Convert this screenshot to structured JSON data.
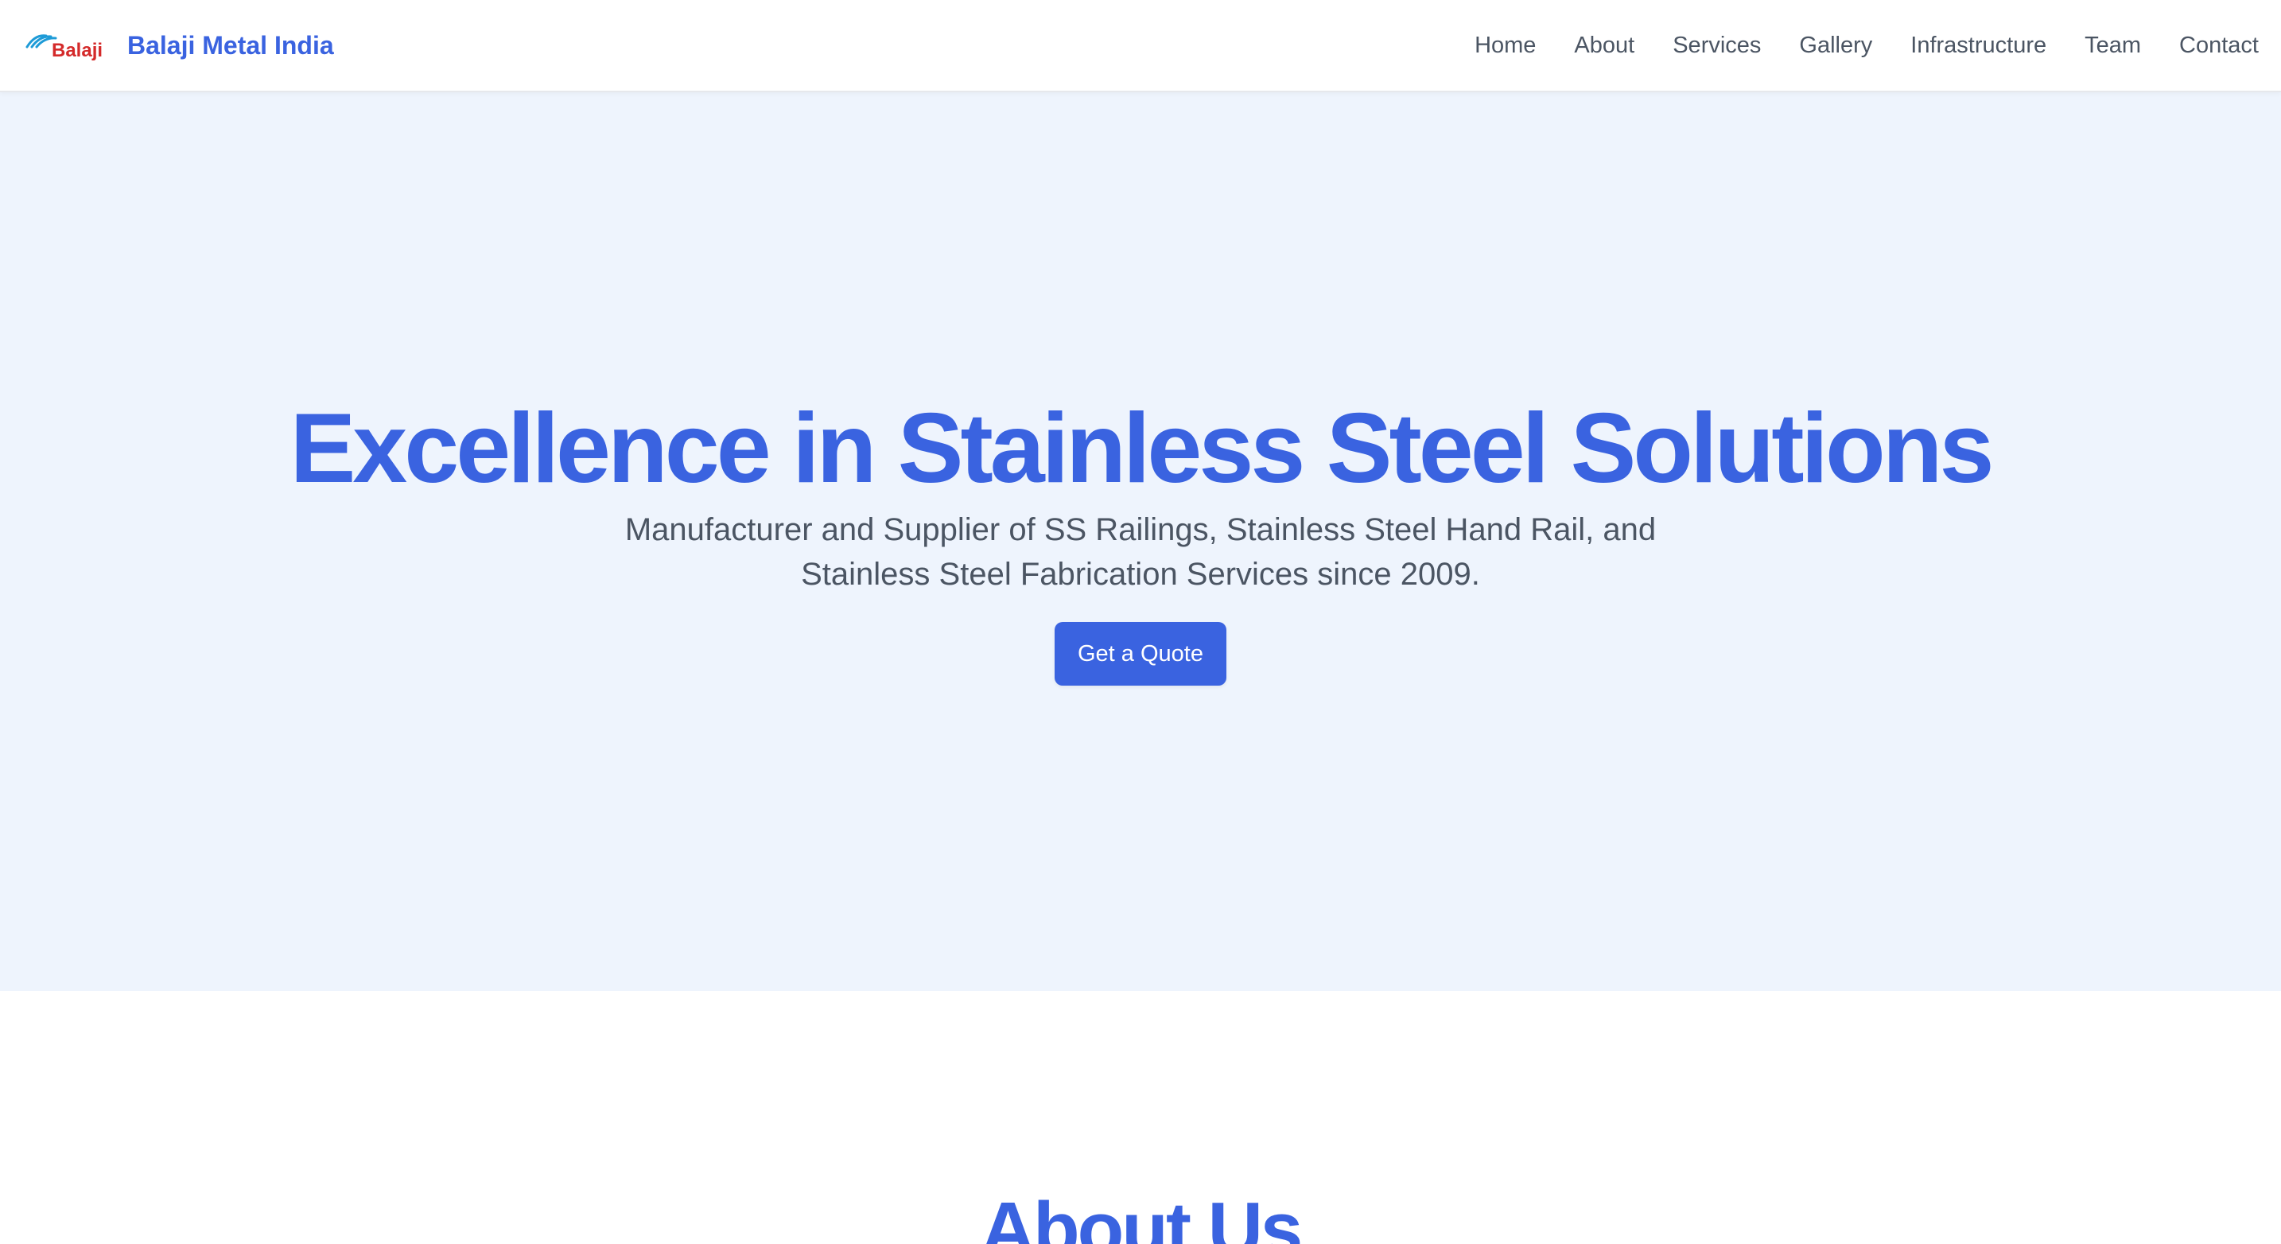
{
  "brand": {
    "logo_text": "Balaji",
    "name": "Balaji Metal India"
  },
  "nav": {
    "items": [
      {
        "label": "Home"
      },
      {
        "label": "About"
      },
      {
        "label": "Services"
      },
      {
        "label": "Gallery"
      },
      {
        "label": "Infrastructure"
      },
      {
        "label": "Team"
      },
      {
        "label": "Contact"
      }
    ]
  },
  "hero": {
    "title": "Excellence in Stainless Steel Solutions",
    "subtitle": "Manufacturer and Supplier of SS Railings, Stainless Steel Hand Rail, and Stainless Steel Fabrication Services since 2009.",
    "cta_label": "Get a Quote"
  },
  "about": {
    "title": "About Us"
  },
  "colors": {
    "accent": "#3a63e0",
    "hero_bg": "#eef4fd",
    "nav_text": "#4b5563",
    "logo_red": "#d42a2a",
    "logo_blue": "#1e9bd7"
  },
  "icons": {
    "logo": "balaji-swoosh-logo"
  }
}
